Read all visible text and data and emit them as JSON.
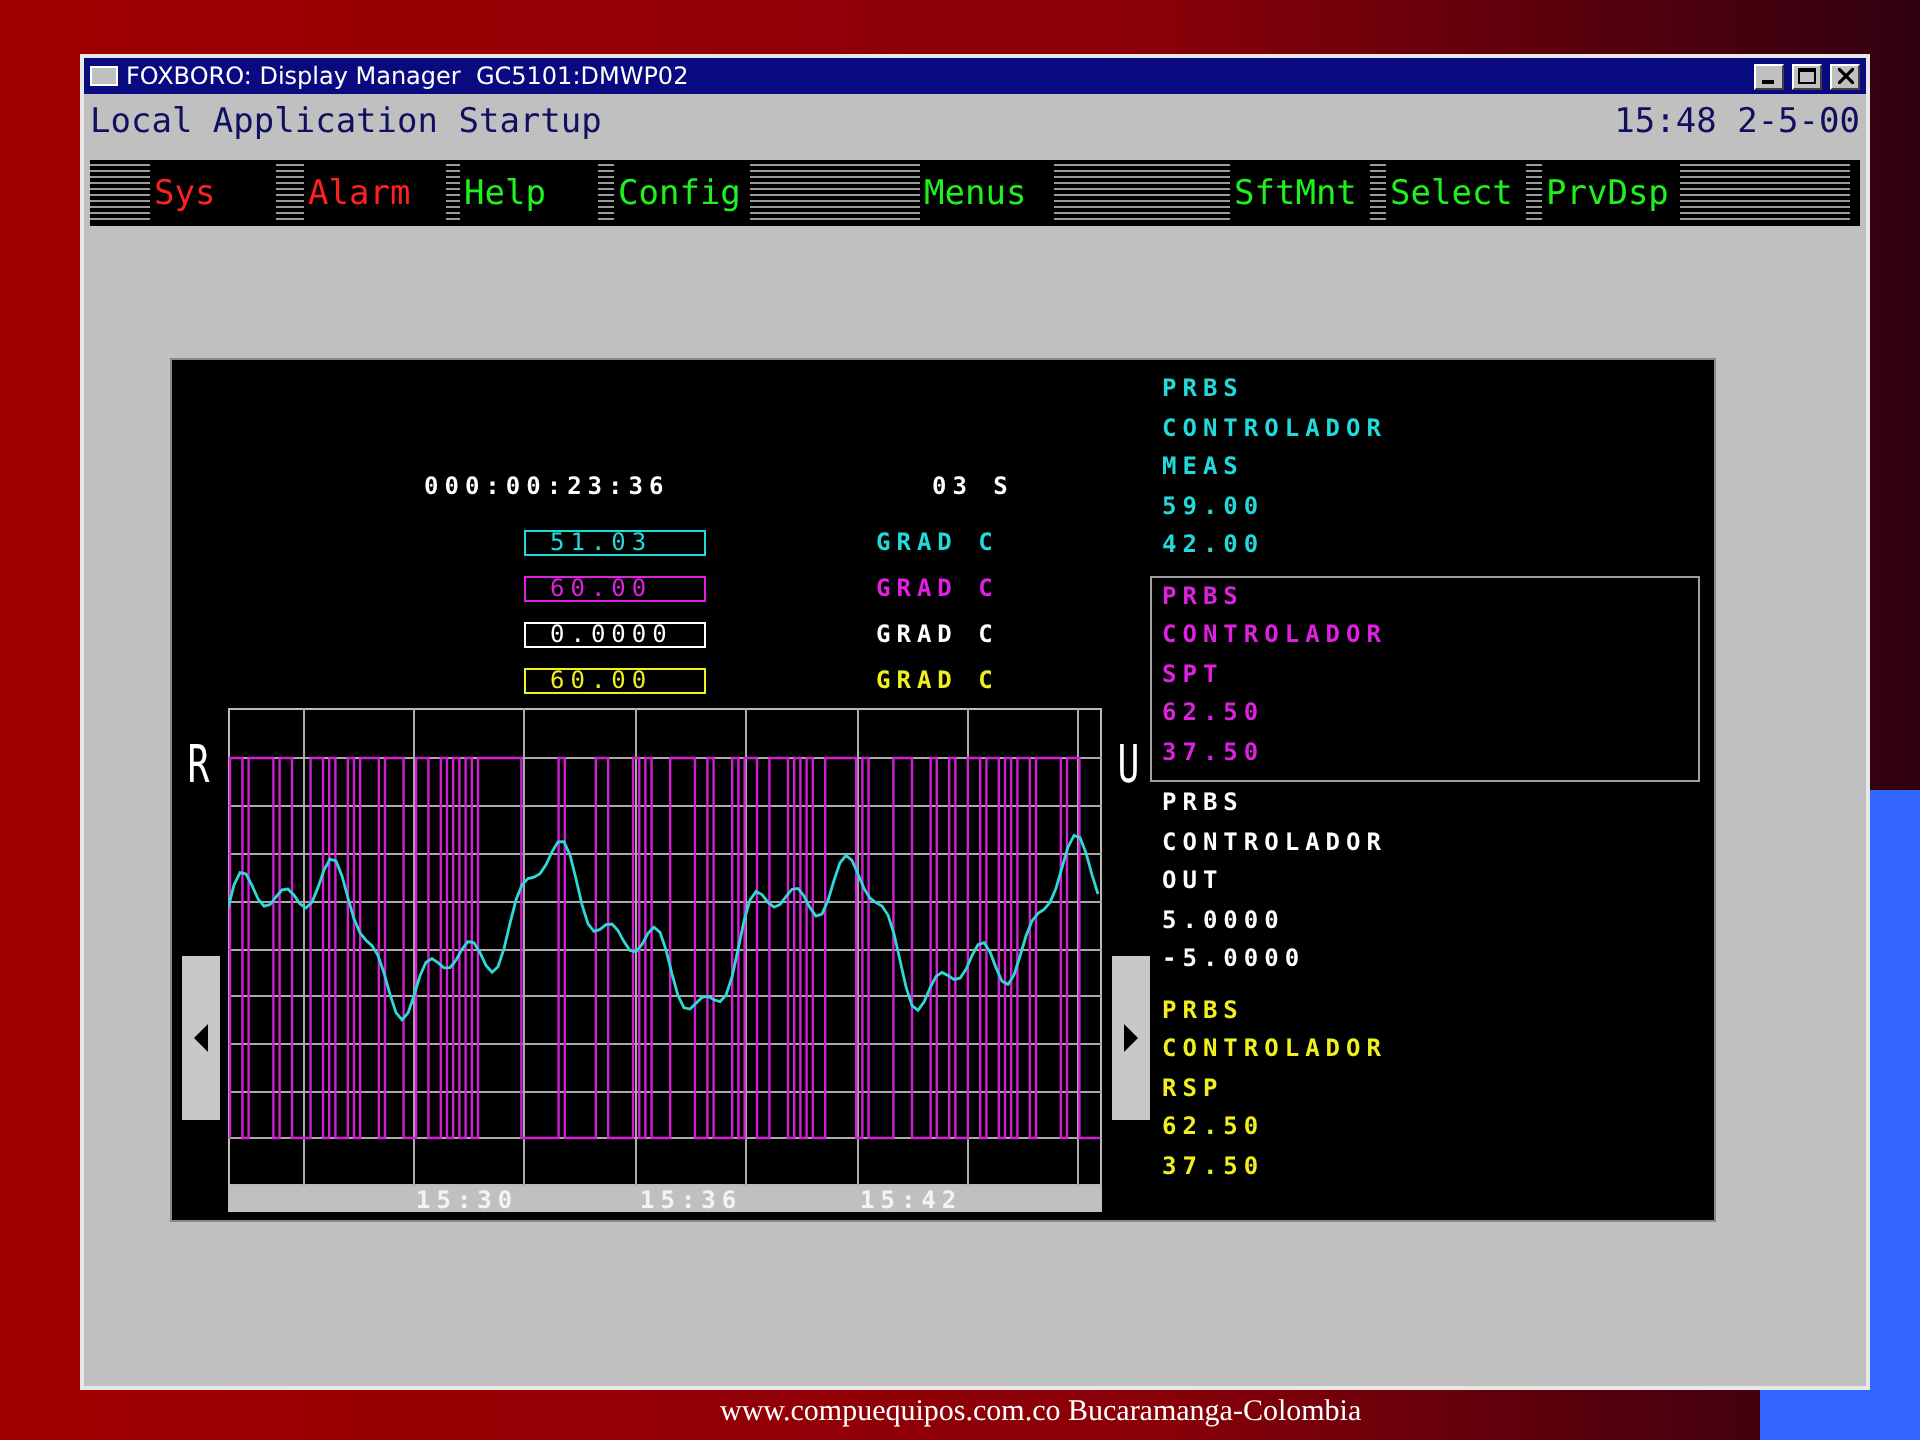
{
  "window": {
    "title": "FOXBORO: Display Manager  GC5101:DMWP02"
  },
  "header": {
    "title": "Local Application Startup",
    "clock": "15:48 2-5-00"
  },
  "menu_bar": [
    {
      "label": "Sys",
      "color": "#ff2020"
    },
    {
      "label": "Alarm",
      "color": "#ff2020"
    },
    {
      "label": "Help",
      "color": "#20f020"
    },
    {
      "label": "Config",
      "color": "#20f020"
    },
    {
      "label": "Menus",
      "color": "#20f020"
    },
    {
      "label": "SftMnt",
      "color": "#20f020"
    },
    {
      "label": "Select",
      "color": "#20f020"
    },
    {
      "label": "PrvDsp",
      "color": "#20f020"
    }
  ],
  "display": {
    "elapsed": "000:00:23:36",
    "period": "03 S",
    "readouts": [
      {
        "value": "51.03",
        "unit": "GRAD C",
        "color": "#22dada"
      },
      {
        "value": "60.00",
        "unit": "GRAD C",
        "color": "#e020e0"
      },
      {
        "value": "0.0000",
        "unit": "GRAD C",
        "color": "#ffffff"
      },
      {
        "value": "60.00",
        "unit": "GRAD C",
        "color": "#f0f020"
      }
    ],
    "trend": {
      "left_label": "R",
      "right_label": "U",
      "time_labels": [
        "15:30",
        "15:36",
        "15:42"
      ]
    },
    "legend": [
      {
        "lines": [
          "PRBS",
          "CONTROLADOR",
          "MEAS",
          "59.00",
          "42.00"
        ],
        "color": "#22dada",
        "selected": false
      },
      {
        "lines": [
          "PRBS",
          "CONTROLADOR",
          "SPT",
          "62.50",
          "37.50"
        ],
        "color": "#e020e0",
        "selected": true
      },
      {
        "lines": [
          "PRBS",
          "CONTROLADOR",
          "OUT",
          "5.0000",
          "-5.0000"
        ],
        "color": "#ffffff",
        "selected": false
      },
      {
        "lines": [
          "PRBS",
          "CONTROLADOR",
          "RSP",
          "62.50",
          "37.50"
        ],
        "color": "#f0f020",
        "selected": false
      }
    ]
  },
  "footer": "www.compuequipos.com.co Bucaramanga-Colombia"
}
